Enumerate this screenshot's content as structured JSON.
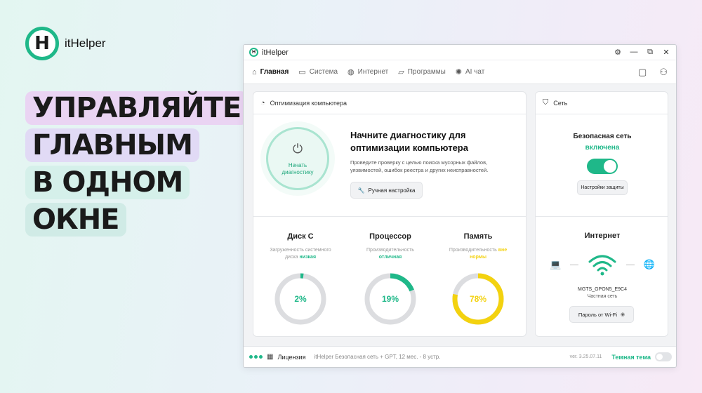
{
  "brand": {
    "logo_letter": "H",
    "name": "itHelper"
  },
  "headline": [
    "УПРАВЛЯЙТЕ",
    "ГЛАВНЫМ",
    "В ОДНОМ",
    "ОКНЕ"
  ],
  "window": {
    "title": "itHelper",
    "logo_letter": "H",
    "controls": {
      "settings": "⚙",
      "minimize": "—",
      "popout": "⧉",
      "close": "✕"
    }
  },
  "nav": {
    "items": [
      {
        "label": "Главная",
        "icon": "home-icon",
        "glyph": "⌂"
      },
      {
        "label": "Система",
        "icon": "monitor-icon",
        "glyph": "▭"
      },
      {
        "label": "Интернет",
        "icon": "globe-icon",
        "glyph": "◍"
      },
      {
        "label": "Программы",
        "icon": "folder-icon",
        "glyph": "▱"
      },
      {
        "label": "AI чат",
        "icon": "ai-icon",
        "glyph": "✺"
      }
    ],
    "chat_glyph": "▢",
    "user_glyph": "⚇"
  },
  "optimization": {
    "header": "Оптимизация компьютера",
    "header_glyph": "◔",
    "diag_button": "Начать диагностику",
    "power_glyph": "⏻",
    "title": "Начните диагностику для оптимизации компьютера",
    "description": "Проведите проверку с целью поиска мусорных файлов, уязвимостей, ошибок реестра и других неисправностей.",
    "manual_button": "Ручная настройка",
    "wrench_glyph": "🔧"
  },
  "metrics": [
    {
      "title": "Диск C",
      "sub_text": "Загруженность системного диска ",
      "status": "низкая",
      "value": 2,
      "label": "2%",
      "color": "#1fb889"
    },
    {
      "title": "Процессор",
      "sub_text": "Производительность ",
      "status": "отличная",
      "value": 19,
      "label": "19%",
      "color": "#1fb889"
    },
    {
      "title": "Память",
      "sub_text": "Производительность ",
      "status": "вне нормы",
      "value": 78,
      "label": "78%",
      "color": "#f3d20f"
    }
  ],
  "network": {
    "header": "Сеть",
    "header_glyph": "⛉",
    "secure_label": "Безопасная сеть",
    "secure_state": "включена",
    "protection_button": "Настройки защиты",
    "internet_title": "Интернет",
    "laptop_glyph": "💻",
    "globe_glyph": "🌐",
    "ssid": "MGTS_GPON5_E9C4",
    "net_type": "Частная сеть",
    "wifi_button": "Пароль от Wi-Fi",
    "eye_glyph": "◉"
  },
  "status_bar": {
    "license_glyph": "▦",
    "license_label": "Лицензия",
    "license_desc": "itHelper Безопасная сеть + GPT, 12 мес. - 8 устр.",
    "version": "ver. 3.25.07.11",
    "dark_theme": "Темная тема"
  },
  "colors": {
    "accent": "#1fb889",
    "warning": "#f3d20f",
    "track": "#dcdde0"
  }
}
